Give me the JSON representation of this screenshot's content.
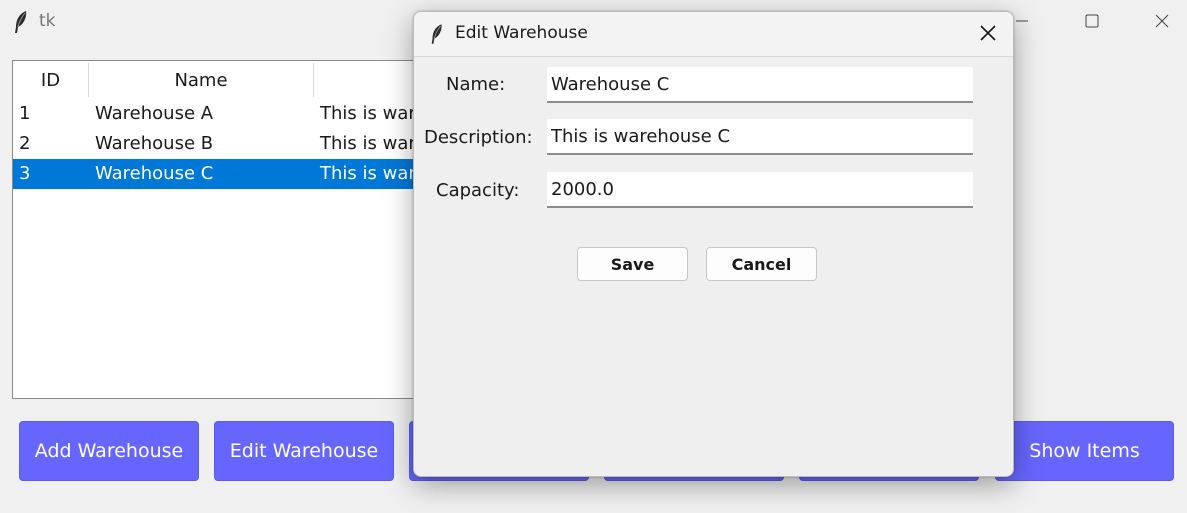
{
  "main_window": {
    "title": "tk",
    "icon": "feather-icon",
    "controls": [
      "minimize-icon",
      "maximize-icon",
      "close-icon"
    ]
  },
  "table": {
    "columns": [
      "ID",
      "Name",
      ""
    ],
    "rows": [
      {
        "id": "1",
        "name": "Warehouse A",
        "description": "This is war"
      },
      {
        "id": "2",
        "name": "Warehouse B",
        "description": "This is war"
      },
      {
        "id": "3",
        "name": "Warehouse C",
        "description": "This is war"
      }
    ],
    "selected_index": 2
  },
  "buttons": {
    "add": "Add Warehouse",
    "edit": "Edit Warehouse",
    "show_items": "Show Items"
  },
  "dialog": {
    "title": "Edit Warehouse",
    "icon": "feather-icon",
    "fields": {
      "name": {
        "label": "Name:",
        "value": "Warehouse C"
      },
      "description": {
        "label": "Description:",
        "value": "This is warehouse C"
      },
      "capacity": {
        "label": "Capacity:",
        "value": "2000.0"
      }
    },
    "save_label": "Save",
    "cancel_label": "Cancel"
  },
  "colors": {
    "accent_button": "#6666ff",
    "selection": "#0078d7"
  }
}
